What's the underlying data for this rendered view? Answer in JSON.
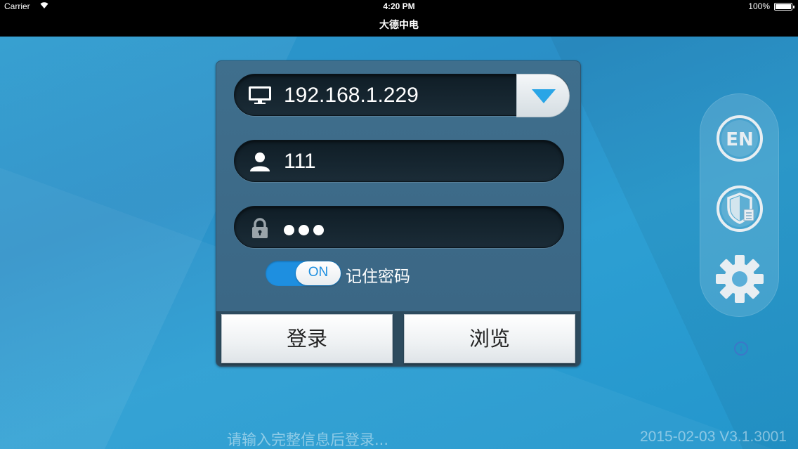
{
  "status_bar": {
    "carrier": "Carrier",
    "time": "4:20 PM",
    "battery": "100%"
  },
  "nav": {
    "title": "大德中电"
  },
  "login": {
    "server_ip": "192.168.1.229",
    "username": "111",
    "password_dots": 3,
    "remember_toggle": {
      "state_label": "ON",
      "on": true
    },
    "remember_label": "记住密码",
    "login_button": "登录",
    "browse_button": "浏览"
  },
  "side_panel": {
    "language_button": "EN",
    "icons": [
      "shield-document-icon",
      "gear-icon"
    ],
    "info_icon": "i"
  },
  "footer": {
    "hint": "请输入完整信息后登录...",
    "version": "2015-02-03 V3.1.3001"
  },
  "colors": {
    "background": "#2b9ccf",
    "panel": "#3f6f8d",
    "field": "#15242e",
    "toggle_on": "#1e8fe0"
  }
}
